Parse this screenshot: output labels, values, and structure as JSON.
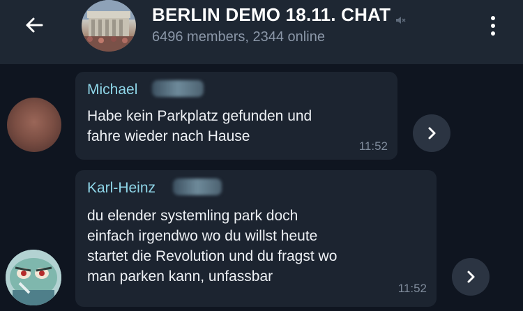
{
  "header": {
    "title": "BERLIN DEMO 18.11. CHAT",
    "subtitle": "6496 members, 2344 online"
  },
  "messages": [
    {
      "sender": "Michael",
      "lines": [
        "Habe kein Parkplatz gefunden und",
        "fahre wieder nach Hause"
      ],
      "time": "11:52"
    },
    {
      "sender": "Karl-Heinz",
      "lines": [
        "du elender systemling park doch",
        "einfach irgendwo wo du willst heute",
        "startet die Revolution und du fragst wo",
        "man parken kann, unfassbar"
      ],
      "time": "11:52"
    }
  ],
  "icons": {
    "back": "arrow-left-icon",
    "mute": "speaker-muted-icon",
    "menu": "more-vertical-icon",
    "forward": "chevron-right-icon"
  },
  "colors": {
    "background": "#0f1520",
    "header": "#1e2733",
    "bubble": "#1c2430",
    "sender_name": "#8fd6e8",
    "timestamp": "#7f8b9b"
  }
}
